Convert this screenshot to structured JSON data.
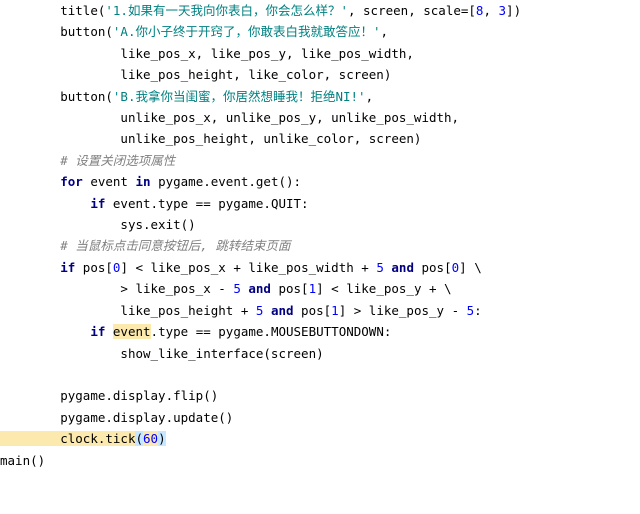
{
  "indent": {
    "i0": "",
    "i4": "    ",
    "i8": "        ",
    "i12": "            ",
    "i16": "                ",
    "i20": "                    "
  },
  "lines": [
    [
      [
        "i8",
        "",
        ""
      ],
      [
        "",
        "title(",
        "pl"
      ],
      [
        "",
        "'1.如果有一天我向你表白，你会怎么样？'",
        "str"
      ],
      [
        "",
        ", screen, scale=[",
        "pl"
      ],
      [
        "",
        "8",
        "num"
      ],
      [
        "",
        ", ",
        "pl"
      ],
      [
        "",
        "3",
        "num"
      ],
      [
        "",
        "])",
        "pl"
      ]
    ],
    [
      [
        "i8",
        "",
        ""
      ],
      [
        "",
        "button(",
        "pl"
      ],
      [
        "",
        "'A.你小子终于开窍了，你敢表白我就敢答应！'",
        "str"
      ],
      [
        "",
        ",",
        "pl"
      ]
    ],
    [
      [
        "i16",
        "",
        ""
      ],
      [
        "",
        "like_pos_x, like_pos_y, like_pos_width,",
        "pl"
      ]
    ],
    [
      [
        "i16",
        "",
        ""
      ],
      [
        "",
        "like_pos_height, like_color, screen)",
        "pl"
      ]
    ],
    [
      [
        "i8",
        "",
        ""
      ],
      [
        "",
        "button(",
        "pl"
      ],
      [
        "",
        "'B.我拿你当闺蜜，你居然想睡我！拒绝NI!'",
        "str"
      ],
      [
        "",
        ",",
        "pl"
      ]
    ],
    [
      [
        "i16",
        "",
        ""
      ],
      [
        "",
        "unlike_pos_x, unlike_pos_y, unlike_pos_width,",
        "pl"
      ]
    ],
    [
      [
        "i16",
        "",
        ""
      ],
      [
        "",
        "unlike_pos_height, unlike_color, screen)",
        "pl"
      ]
    ],
    [
      [
        "i8",
        "",
        ""
      ],
      [
        "",
        "# 设置关闭选项属性",
        "cm"
      ]
    ],
    [
      [
        "i8",
        "",
        ""
      ],
      [
        "",
        "for",
        "kw"
      ],
      [
        "",
        " event ",
        "pl"
      ],
      [
        "",
        "in",
        "kw"
      ],
      [
        "",
        " pygame.event.get():",
        "pl"
      ]
    ],
    [
      [
        "i12",
        "",
        ""
      ],
      [
        "",
        "if",
        "kw"
      ],
      [
        "",
        " event.type == pygame.QUIT:",
        "pl"
      ]
    ],
    [
      [
        "i16",
        "",
        ""
      ],
      [
        "",
        "sys.exit()",
        "pl"
      ]
    ],
    [
      [
        "i8",
        "",
        ""
      ],
      [
        "",
        "# 当鼠标点击同意按钮后, 跳转结束页面",
        "cm"
      ]
    ],
    [
      [
        "i8",
        "",
        ""
      ],
      [
        "",
        "if",
        "kw"
      ],
      [
        "",
        " pos[",
        "pl"
      ],
      [
        "",
        "0",
        "num"
      ],
      [
        "",
        "] < like_pos_x + like_pos_width + ",
        "pl"
      ],
      [
        "",
        "5",
        "num"
      ],
      [
        "",
        " ",
        "pl"
      ],
      [
        "",
        "and",
        "kw"
      ],
      [
        "",
        " pos[",
        "pl"
      ],
      [
        "",
        "0",
        "num"
      ],
      [
        "",
        "] \\",
        "pl"
      ]
    ],
    [
      [
        "i16",
        "",
        ""
      ],
      [
        "",
        "> like_pos_x - ",
        "pl"
      ],
      [
        "",
        "5",
        "num"
      ],
      [
        "",
        " ",
        "pl"
      ],
      [
        "",
        "and",
        "kw"
      ],
      [
        "",
        " pos[",
        "pl"
      ],
      [
        "",
        "1",
        "num"
      ],
      [
        "",
        "] < like_pos_y + \\",
        "pl"
      ]
    ],
    [
      [
        "i16",
        "",
        ""
      ],
      [
        "",
        "like_pos_height + ",
        "pl"
      ],
      [
        "",
        "5",
        "num"
      ],
      [
        "",
        " ",
        "pl"
      ],
      [
        "",
        "and",
        "kw"
      ],
      [
        "",
        " pos[",
        "pl"
      ],
      [
        "",
        "1",
        "num"
      ],
      [
        "",
        "] > like_pos_y - ",
        "pl"
      ],
      [
        "",
        "5",
        "num"
      ],
      [
        "",
        ":",
        "pl"
      ]
    ],
    [
      [
        "i12",
        "",
        ""
      ],
      [
        "",
        "if",
        "kw"
      ],
      [
        "",
        " ",
        "pl"
      ],
      [
        "",
        "event",
        "pl",
        "hl1"
      ],
      [
        "",
        ".type == pygame.MOUSEBUTTONDOWN:",
        "pl"
      ]
    ],
    [
      [
        "i16",
        "",
        ""
      ],
      [
        "",
        "show_like_interface(screen)",
        "pl"
      ]
    ],
    [
      [
        "",
        "",
        ""
      ]
    ],
    [
      [
        "i8",
        "",
        ""
      ],
      [
        "",
        "pygame.display.flip()",
        "pl"
      ]
    ],
    [
      [
        "i8",
        "",
        ""
      ],
      [
        "",
        "pygame.display.update()",
        "pl"
      ]
    ],
    [
      [
        "i8",
        "",
        ""
      ],
      [
        "",
        "clock.tick",
        "pl"
      ],
      [
        "",
        "(",
        "pl",
        "hlp"
      ],
      [
        "",
        "60",
        "num",
        "hl1"
      ],
      [
        "",
        ")",
        "pl",
        "hlp"
      ]
    ],
    [
      [
        "i0",
        "",
        ""
      ],
      [
        "",
        "main()",
        "pl"
      ]
    ]
  ],
  "line_bg": {
    "20": "hl1"
  }
}
